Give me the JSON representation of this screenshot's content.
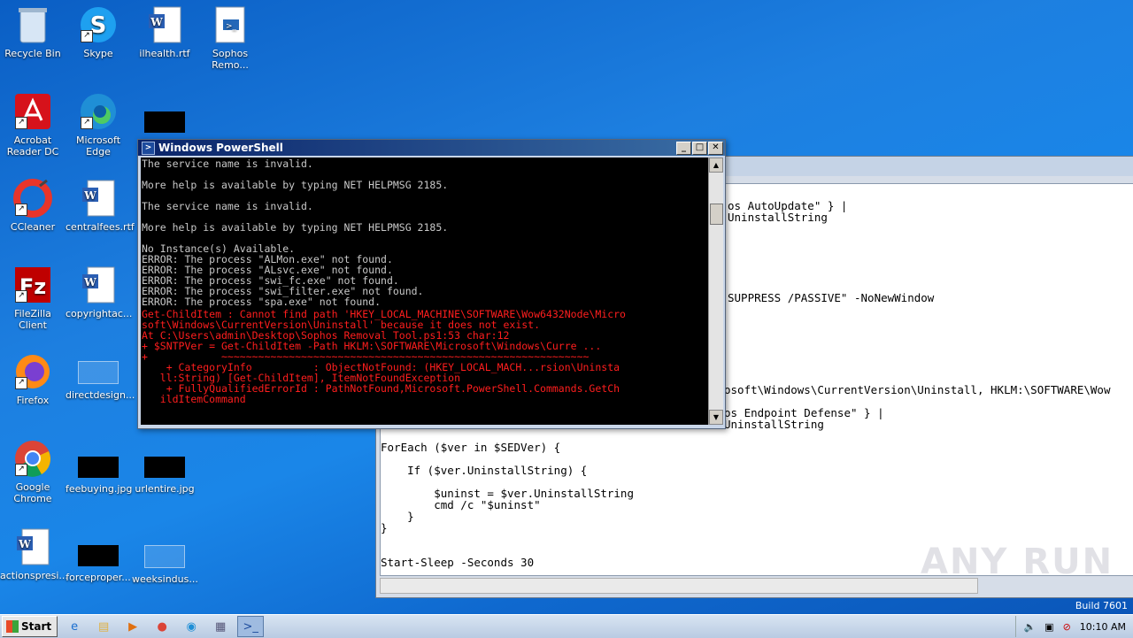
{
  "desktop": {
    "icons": [
      {
        "label": "Recycle Bin",
        "icon": "recycle-bin-icon"
      },
      {
        "label": "Skype",
        "icon": "skype-icon"
      },
      {
        "label": "ilhealth.rtf",
        "icon": "word-doc-icon"
      },
      {
        "label": "Sophos\nRemo...",
        "icon": "powershell-script-icon"
      },
      {
        "label": "Acrobat\nReader DC",
        "icon": "acrobat-icon"
      },
      {
        "label": "Microsoft Edge",
        "icon": "edge-icon"
      },
      {
        "label": "CCleaner",
        "icon": "ccleaner-icon"
      },
      {
        "label": "centralfees.rtf",
        "icon": "word-doc-icon"
      },
      {
        "label": "FileZilla Client",
        "icon": "filezilla-icon"
      },
      {
        "label": "copyrightac...",
        "icon": "word-doc-icon"
      },
      {
        "label": "Firefox",
        "icon": "firefox-icon"
      },
      {
        "label": "directdesign...",
        "icon": "file-icon"
      },
      {
        "label": "Google\nChrome",
        "icon": "chrome-icon"
      },
      {
        "label": "feebuying.jpg",
        "icon": "image-icon"
      },
      {
        "label": "urlentire.jpg",
        "icon": "image-icon"
      },
      {
        "label": "actionspresi...",
        "icon": "word-doc-icon"
      },
      {
        "label": "forceproper...",
        "icon": "image-icon"
      },
      {
        "label": "weeksindus...",
        "icon": "file-icon"
      }
    ]
  },
  "powershell": {
    "title": "Windows PowerShell",
    "lines_white": "The service name is invalid.\n\nMore help is available by typing NET HELPMSG 2185.\n\nThe service name is invalid.\n\nMore help is available by typing NET HELPMSG 2185.\n\nNo Instance(s) Available.\nERROR: The process \"ALMon.exe\" not found.\nERROR: The process \"ALsvc.exe\" not found.\nERROR: The process \"swi_fc.exe\" not found.\nERROR: The process \"swi_filter.exe\" not found.\nERROR: The process \"spa.exe\" not found.",
    "lines_red": "Get-ChildItem : Cannot find path 'HKEY_LOCAL_MACHINE\\SOFTWARE\\Wow6432Node\\Micro\nsoft\\Windows\\CurrentVersion\\Uninstall' because it does not exist.\nAt C:\\Users\\admin\\Desktop\\Sophos Removal Tool.ps1:53 char:12\n+ $SNTPVer = Get-ChildItem -Path HKLM:\\SOFTWARE\\Microsoft\\Windows\\Curre ...\n+            ~~~~~~~~~~~~~~~~~~~~~~~~~~~~~~~~~~~~~~~~~~~~~~~~~~~~~~~~~~~~\n    + CategoryInfo          : ObjectNotFound: (HKEY_LOCAL_MACH...rsion\\Uninsta\n   ll:String) [Get-ChildItem], ItemNotFoundException\n    + FullyQualifiedErrorId : PathNotFound,Microsoft.PowerShell.Commands.GetCh\n   ildItemCommand"
  },
  "editor": {
    "code_top": "os AutoUpdate\" } |\nUninstallString",
    "code_mid": "SUPPRESS /PASSIVE\" -NoNewWindow",
    "code_low": "osoft\\Windows\\CurrentVersion\\Uninstall, HKLM:\\SOFTWARE\\Wow\n\nos Endpoint Defense\" } |\nUninstallString",
    "code_main": "ForEach ($ver in $SEDVer) {\n\n    If ($ver.UninstallString) {\n\n        $uninst = $ver.UninstallString\n        cmd /c \"$uninst\"\n    }\n}\n\n\nStart-Sleep -Seconds 30"
  },
  "watermark": "ANY RUN",
  "build": "Build 7601",
  "taskbar": {
    "start_label": "Start",
    "buttons": [
      "ie-icon",
      "explorer-icon",
      "media-player-icon",
      "chrome-icon",
      "edge-icon",
      "notepad-icon",
      "powershell-icon"
    ],
    "clock": "10:10 AM"
  }
}
